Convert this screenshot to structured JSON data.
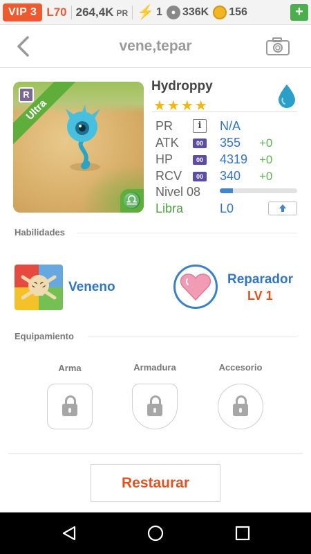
{
  "topbar": {
    "vip": "VIP 3",
    "level": "L70",
    "pr_value": "264,4K",
    "pr_unit": "PR",
    "energy": "1",
    "paws": "336K",
    "coins": "156",
    "plus": "+"
  },
  "header": {
    "title": "vene,tepar",
    "back_icon": "chevron-left-icon",
    "camera_icon": "camera-icon"
  },
  "monster": {
    "name": "Hydroppy",
    "rarity": "Ultra",
    "rank_badge": "R",
    "stars": "★★★★",
    "element_icon": "water-drop-icon",
    "zodiac_symbol": "♎",
    "stats": {
      "pr_label": "PR",
      "pr_value": "N/A",
      "atk_label": "ATK",
      "atk_value": "355",
      "atk_bonus": "+0",
      "hp_label": "HP",
      "hp_value": "4319",
      "hp_bonus": "+0",
      "rcv_label": "RCV",
      "rcv_value": "340",
      "rcv_bonus": "+0",
      "level_label": "Nivel 08",
      "level_progress": 0.17,
      "sign_label": "Libra",
      "sign_level": "L0",
      "info_symbol": "i",
      "badge_text": "00"
    }
  },
  "skills": {
    "section_label": "Habilidades",
    "skill1_name": "Veneno",
    "skill2_name": "Reparador",
    "skill2_level": "LV 1"
  },
  "equipment": {
    "section_label": "Equipamiento",
    "slots": [
      "Arma",
      "Armadura",
      "Accesorio"
    ]
  },
  "actions": {
    "restore_label": "Restaurar"
  },
  "colors": {
    "accent_orange": "#e2531d",
    "link_blue": "#2f76c7",
    "ultra_green": "#5fae3c"
  }
}
